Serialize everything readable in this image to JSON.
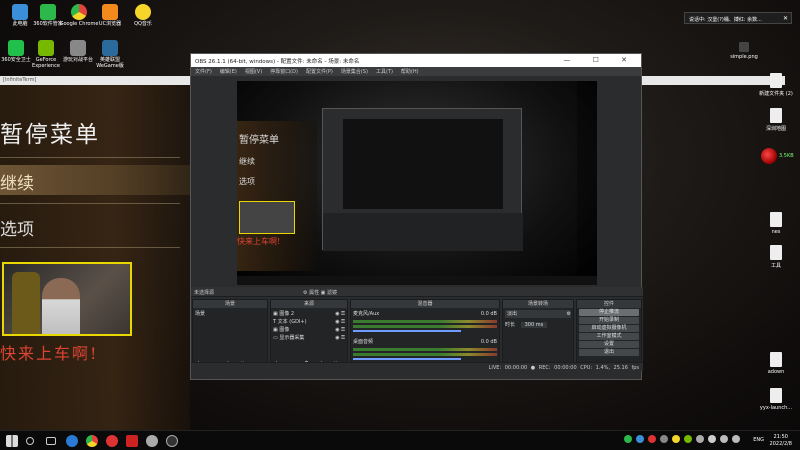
{
  "desktop_icons": [
    {
      "label": "此电脑",
      "color": "#3a8fd8"
    },
    {
      "label": "360软件管家",
      "color": "#2db84b"
    },
    {
      "label": "Google Chrome",
      "color": "#e2453c"
    },
    {
      "label": "UC浏览器",
      "color": "#f28a1e"
    },
    {
      "label": "QQ音乐",
      "color": "#f6d52b"
    },
    {
      "label": "360安全卫士",
      "color": "#21c04a"
    },
    {
      "label": "GeForce Experience",
      "color": "#76b900"
    },
    {
      "label": "游玩对战平台",
      "color": "#888888"
    },
    {
      "label": "英雄联盟 WeGame版",
      "color": "#2a6b9b"
    }
  ],
  "game_window": {
    "title_bar": "[InfiniteTerm]",
    "menu_title": "暂停菜单",
    "menu_item_selected": "继续",
    "menu_item_2": "选项",
    "banner": "快来上车啊!"
  },
  "obs": {
    "title": "OBS 26.1.1 (64-bit, windows) - 配置文件: 未命名 - 场景: 未命名",
    "window_controls": "—  ☐  ✕",
    "menus": [
      "文件(F)",
      "编辑(E)",
      "视图(V)",
      "停靠窗口(D)",
      "配置文件(P)",
      "场景集合(S)",
      "工具(T)",
      "帮助(H)"
    ],
    "preview": {
      "menu_title": "暂停菜单",
      "item_1": "继续",
      "item_2": "选项",
      "banner": "快来上车啊!"
    },
    "scene_label": "未选择源",
    "scene_header_buttons": "⚙ 属性  ▣ 滤镜",
    "docks": {
      "scenes": {
        "title": "场景",
        "items": [
          "场景"
        ],
        "footer": "+ − ∧ ∨"
      },
      "sources": {
        "title": "来源",
        "items": [
          {
            "icon": "image-icon",
            "label": "图像 2"
          },
          {
            "icon": "text-icon",
            "label": "文本 (GDI+)"
          },
          {
            "icon": "image-icon",
            "label": "图像"
          },
          {
            "icon": "monitor-icon",
            "label": "显示器采集"
          }
        ],
        "footer": "+ − ⚙ ∧ ∨"
      },
      "mixer": {
        "title": "混音器",
        "channels": [
          {
            "name": "麦克风/Aux",
            "db": "0.0 dB"
          },
          {
            "name": "桌面音频",
            "db": "0.0 dB"
          }
        ]
      },
      "transitions": {
        "title": "场景转场",
        "type": "淡出",
        "duration_label": "时长",
        "duration_value": "300 ms"
      },
      "controls": {
        "title": "控件",
        "buttons": [
          "停止推流",
          "开始录制",
          "启动虚拟摄像机",
          "工作室模式",
          "设置",
          "退出"
        ]
      }
    },
    "status": {
      "live_label": "LIVE:",
      "live_time": "00:00:00",
      "rec_label": "REC:",
      "rec_time": "00:00:00",
      "cpu": "CPU: 1.4%, 25.16 fps"
    }
  },
  "notification": {
    "text": "说话中: 汉堡(?)桶、搏红: 余数...",
    "close": "✕"
  },
  "right_icons": [
    {
      "label": "simple.png"
    },
    {
      "label": "新建文件夹 (2)"
    },
    {
      "label": "深圳地图"
    },
    {
      "label": "nes"
    },
    {
      "label": "工具"
    },
    {
      "label": "adown"
    },
    {
      "label": "yyx-launch..."
    }
  ],
  "gadget": {
    "percent": "3.5KB"
  },
  "taskbar": {
    "lang": "ENG",
    "time": "21:50",
    "date": "2022/2/8"
  }
}
